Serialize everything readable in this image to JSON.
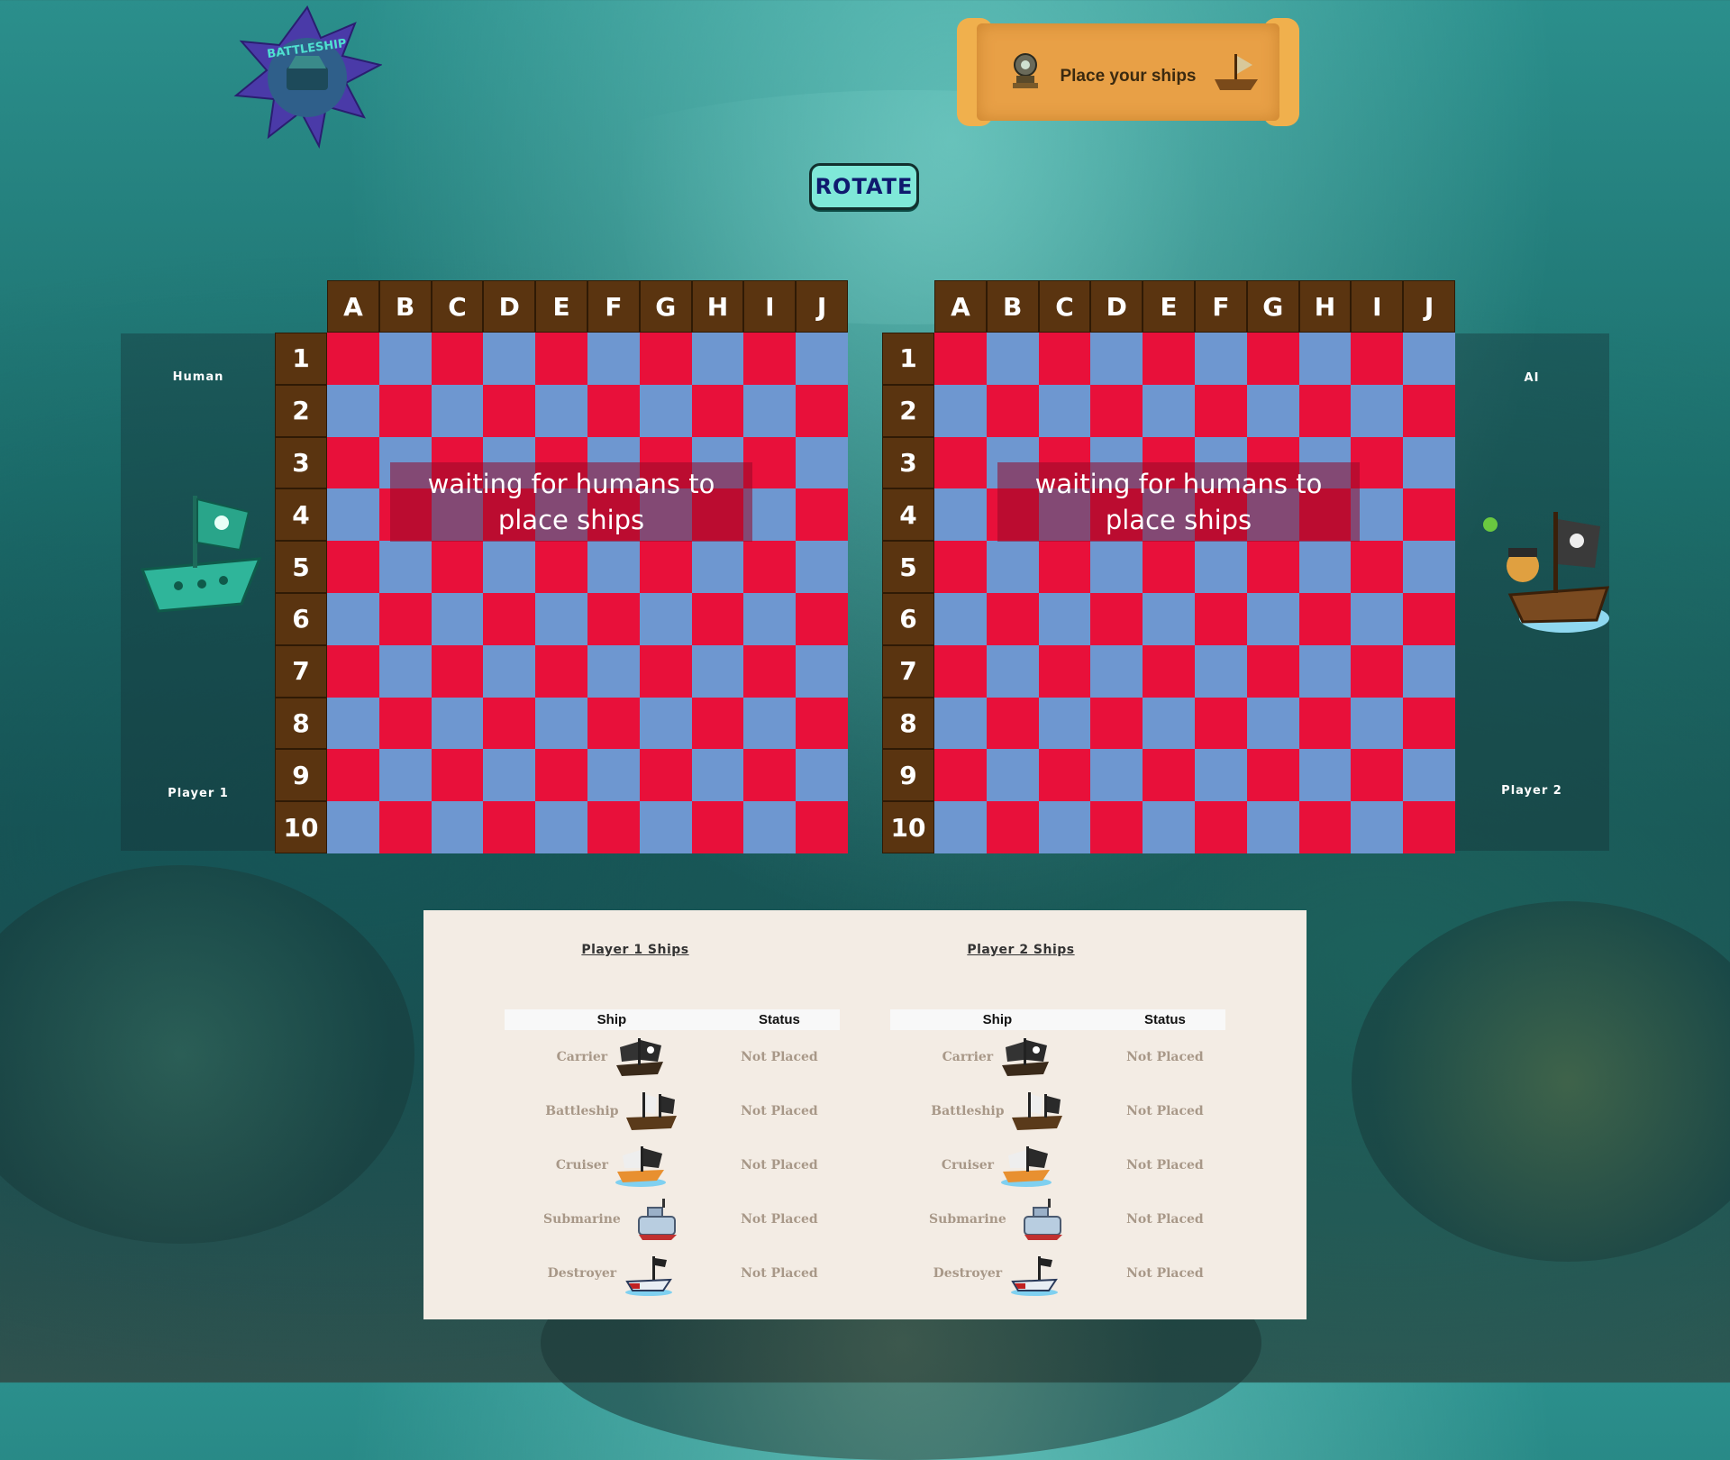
{
  "banner": {
    "text": "Place your ships"
  },
  "rotate_label": "ROTATE",
  "logo_text": "BATTLESHIP",
  "left_panel": {
    "top_label": "Human",
    "bottom_label": "Player 1"
  },
  "right_panel": {
    "top_label": "AI",
    "bottom_label": "Player 2"
  },
  "columns": [
    "A",
    "B",
    "C",
    "D",
    "E",
    "F",
    "G",
    "H",
    "I",
    "J"
  ],
  "rows": [
    "1",
    "2",
    "3",
    "4",
    "5",
    "6",
    "7",
    "8",
    "9",
    "10"
  ],
  "boards": [
    {
      "id": "player1",
      "overlay": "waiting for humans to place ships"
    },
    {
      "id": "player2",
      "overlay": "waiting for humans to place ships"
    }
  ],
  "ships_panel": {
    "player1_title": "Player 1 Ships",
    "player2_title": "Player 2 Ships",
    "header_ship": "Ship",
    "header_status": "Status",
    "ships": [
      {
        "name": "Carrier",
        "status": "Not Placed",
        "icon": "pirate-ship-black-icon"
      },
      {
        "name": "Battleship",
        "status": "Not Placed",
        "icon": "pirate-ship-large-icon"
      },
      {
        "name": "Cruiser",
        "status": "Not Placed",
        "icon": "pirate-ship-orange-icon"
      },
      {
        "name": "Submarine",
        "status": "Not Placed",
        "icon": "submarine-icon"
      },
      {
        "name": "Destroyer",
        "status": "Not Placed",
        "icon": "small-boat-icon"
      }
    ]
  },
  "colors": {
    "cell_red": "#e8103a",
    "cell_blue": "#6e97d0",
    "header_brown": "#5a3410"
  }
}
